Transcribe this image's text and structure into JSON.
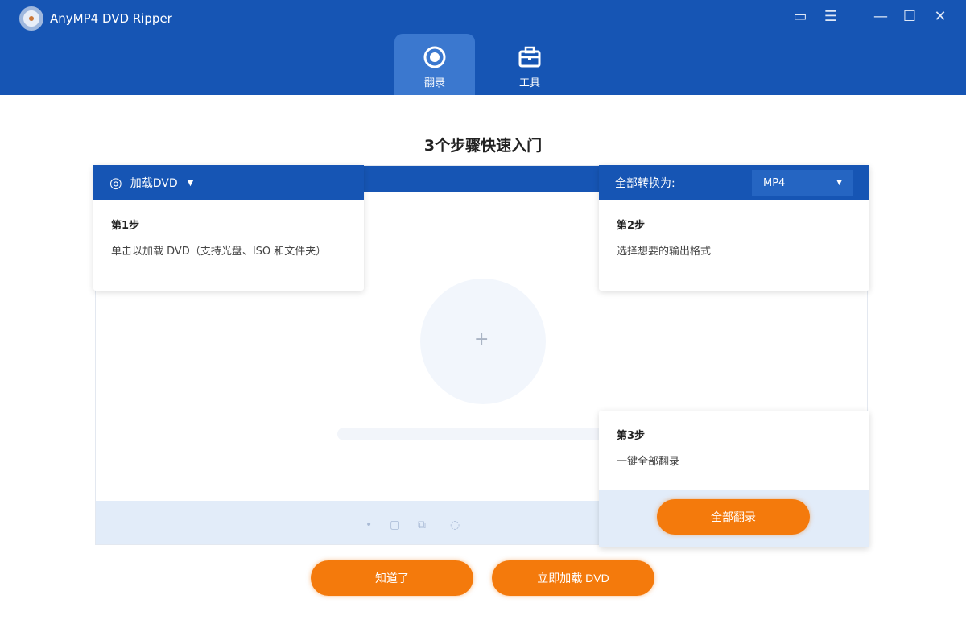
{
  "app": {
    "title": "AnyMP4 DVD Ripper"
  },
  "tabs": [
    {
      "label": "翻录"
    },
    {
      "label": "工具"
    }
  ],
  "heading": "3个步骤快速入门",
  "step1": {
    "header": "加载DVD",
    "step": "第1步",
    "desc": "单击以加载 DVD（支持光盘、ISO 和文件夹）"
  },
  "step2": {
    "header": "全部转换为:",
    "format": "MP4",
    "step": "第2步",
    "desc": "选择想要的输出格式"
  },
  "step3": {
    "step": "第3步",
    "desc": "一键全部翻录",
    "button": "全部翻录"
  },
  "buttons": {
    "got_it": "知道了",
    "load_now": "立即加载 DVD"
  },
  "colors": {
    "primary": "#1655b4",
    "accent": "#f47a0c"
  }
}
